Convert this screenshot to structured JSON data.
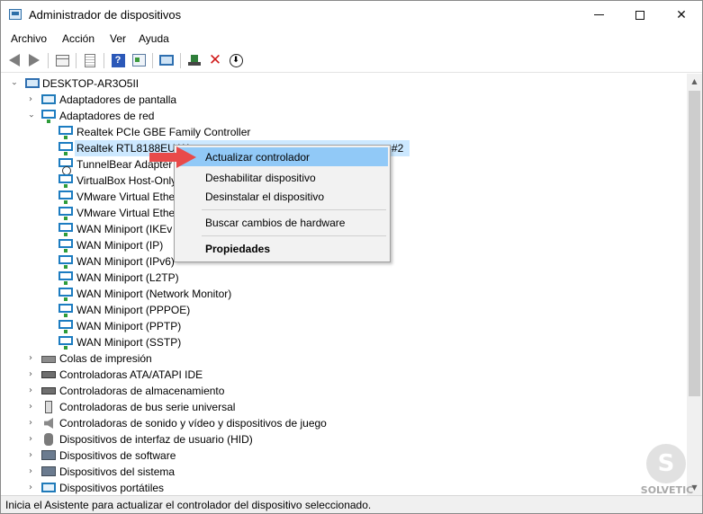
{
  "window": {
    "title": "Administrador de dispositivos",
    "minimize": "",
    "maximize": "",
    "close": "✕"
  },
  "menu": [
    "Archivo",
    "Acción",
    "Ver",
    "Ayuda"
  ],
  "toolbar": {
    "icons": [
      "back-arrow",
      "forward-arrow",
      "console-tree",
      "properties-page",
      "help",
      "device-properties",
      "scan-hardware-monitor",
      "update-driver",
      "uninstall",
      "disable-device"
    ],
    "help_glyph": "?",
    "uninstall_glyph": "✕",
    "disable_glyph": "⬇"
  },
  "tree": {
    "toggle_collapsed": "›",
    "root": "DESKTOP-AR3O5II",
    "items": [
      {
        "label": "Adaptadores de pantalla",
        "icon": "monitor-icon"
      },
      {
        "label": "Adaptadores de red",
        "icon": "network-adapter-icon"
      },
      {
        "label": "Realtek PCIe GBE Family Controller",
        "icon": "network-adapter-icon"
      },
      {
        "label": "Realtek RTL8188EU W",
        "suffix": "#2",
        "icon": "network-adapter-icon"
      },
      {
        "label": "TunnelBear Adapter",
        "icon": "network-adapter-warning-icon"
      },
      {
        "label": "VirtualBox Host-Only",
        "icon": "network-adapter-icon"
      },
      {
        "label": "VMware Virtual Ethe",
        "icon": "network-adapter-icon"
      },
      {
        "label": "VMware Virtual Ethe",
        "icon": "network-adapter-icon"
      },
      {
        "label": "WAN Miniport (IKEv",
        "icon": "network-adapter-icon"
      },
      {
        "label": "WAN Miniport (IP)",
        "icon": "network-adapter-icon"
      },
      {
        "label": "WAN Miniport (IPv6)",
        "icon": "network-adapter-icon"
      },
      {
        "label": "WAN Miniport (L2TP)",
        "icon": "network-adapter-icon"
      },
      {
        "label": "WAN Miniport (Network Monitor)",
        "icon": "network-adapter-icon"
      },
      {
        "label": "WAN Miniport (PPPOE)",
        "icon": "network-adapter-icon"
      },
      {
        "label": "WAN Miniport (PPTP)",
        "icon": "network-adapter-icon"
      },
      {
        "label": "WAN Miniport (SSTP)",
        "icon": "network-adapter-icon"
      },
      {
        "label": "Colas de impresión",
        "icon": "printer-icon"
      },
      {
        "label": "Controladoras ATA/ATAPI IDE",
        "icon": "ide-controller-icon"
      },
      {
        "label": "Controladoras de almacenamiento",
        "icon": "storage-controller-icon"
      },
      {
        "label": "Controladoras de bus serie universal",
        "icon": "usb-icon"
      },
      {
        "label": "Controladoras de sonido y vídeo y dispositivos de juego",
        "icon": "speaker-icon"
      },
      {
        "label": "Dispositivos de interfaz de usuario (HID)",
        "icon": "hid-icon"
      },
      {
        "label": "Dispositivos de software",
        "icon": "software-device-icon"
      },
      {
        "label": "Dispositivos del sistema",
        "icon": "system-device-icon"
      },
      {
        "label": "Dispositivos portátiles",
        "icon": "portable-device-icon"
      }
    ]
  },
  "context_menu": {
    "items": [
      {
        "label": "Actualizar controlador",
        "highlighted": true
      },
      {
        "label": "Deshabilitar dispositivo"
      },
      {
        "label": "Desinstalar el dispositivo"
      },
      {
        "label": "Buscar cambios de hardware"
      },
      {
        "label": "Propiedades",
        "bold": true
      }
    ]
  },
  "status": "Inicia el Asistente para actualizar el controlador del dispositivo seleccionado.",
  "scrollbar": {
    "up": "▲",
    "down": "▼"
  },
  "watermark": {
    "glyph": "S",
    "text": "SOLVETIC"
  },
  "colors": {
    "selection": "#cce8ff",
    "menu_highlight": "#91c9f7",
    "annotation_arrow": "#e84a4a"
  }
}
